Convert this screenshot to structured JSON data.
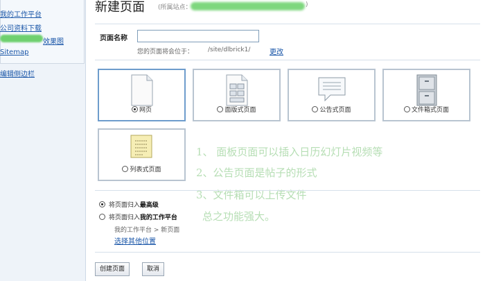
{
  "sidebar": {
    "items": [
      {
        "label": "我的工作平台"
      },
      {
        "label": "公司资料下载"
      },
      {
        "label": "效果图"
      },
      {
        "label": "Sitemap"
      },
      {
        "label": "编辑侧边栏"
      }
    ]
  },
  "header": {
    "title": "新建页面",
    "site_prefix": "(所属站点：",
    "site_suffix": ")"
  },
  "form": {
    "name_label": "页面名称",
    "name_value": "",
    "location_text": "您的页面将会位于：",
    "location_path": "/site/dlbrick1/",
    "change_link": "更改"
  },
  "types": [
    {
      "label": "网页",
      "selected": true
    },
    {
      "label": "面版式页面",
      "selected": false
    },
    {
      "label": "公告式页面",
      "selected": false
    },
    {
      "label": "文件箱式页面",
      "selected": false
    },
    {
      "label": "列表式页面",
      "selected": false
    }
  ],
  "notes": [
    "1、 面板页面可以插入日历幻灯片视频等",
    "2、公告页面是帖子的形式",
    "3、文件箱可以上传文件",
    "总之功能强大。"
  ],
  "placement": {
    "top_prefix": "将页面归入",
    "top_bold": "最高级",
    "platform_prefix": "将页面归入",
    "platform_bold": "我的工作平台",
    "breadcrumb": "我的工作平台 > 新页面",
    "other_link": "选择其他位置"
  },
  "buttons": {
    "create": "创建页面",
    "cancel": "取消"
  }
}
